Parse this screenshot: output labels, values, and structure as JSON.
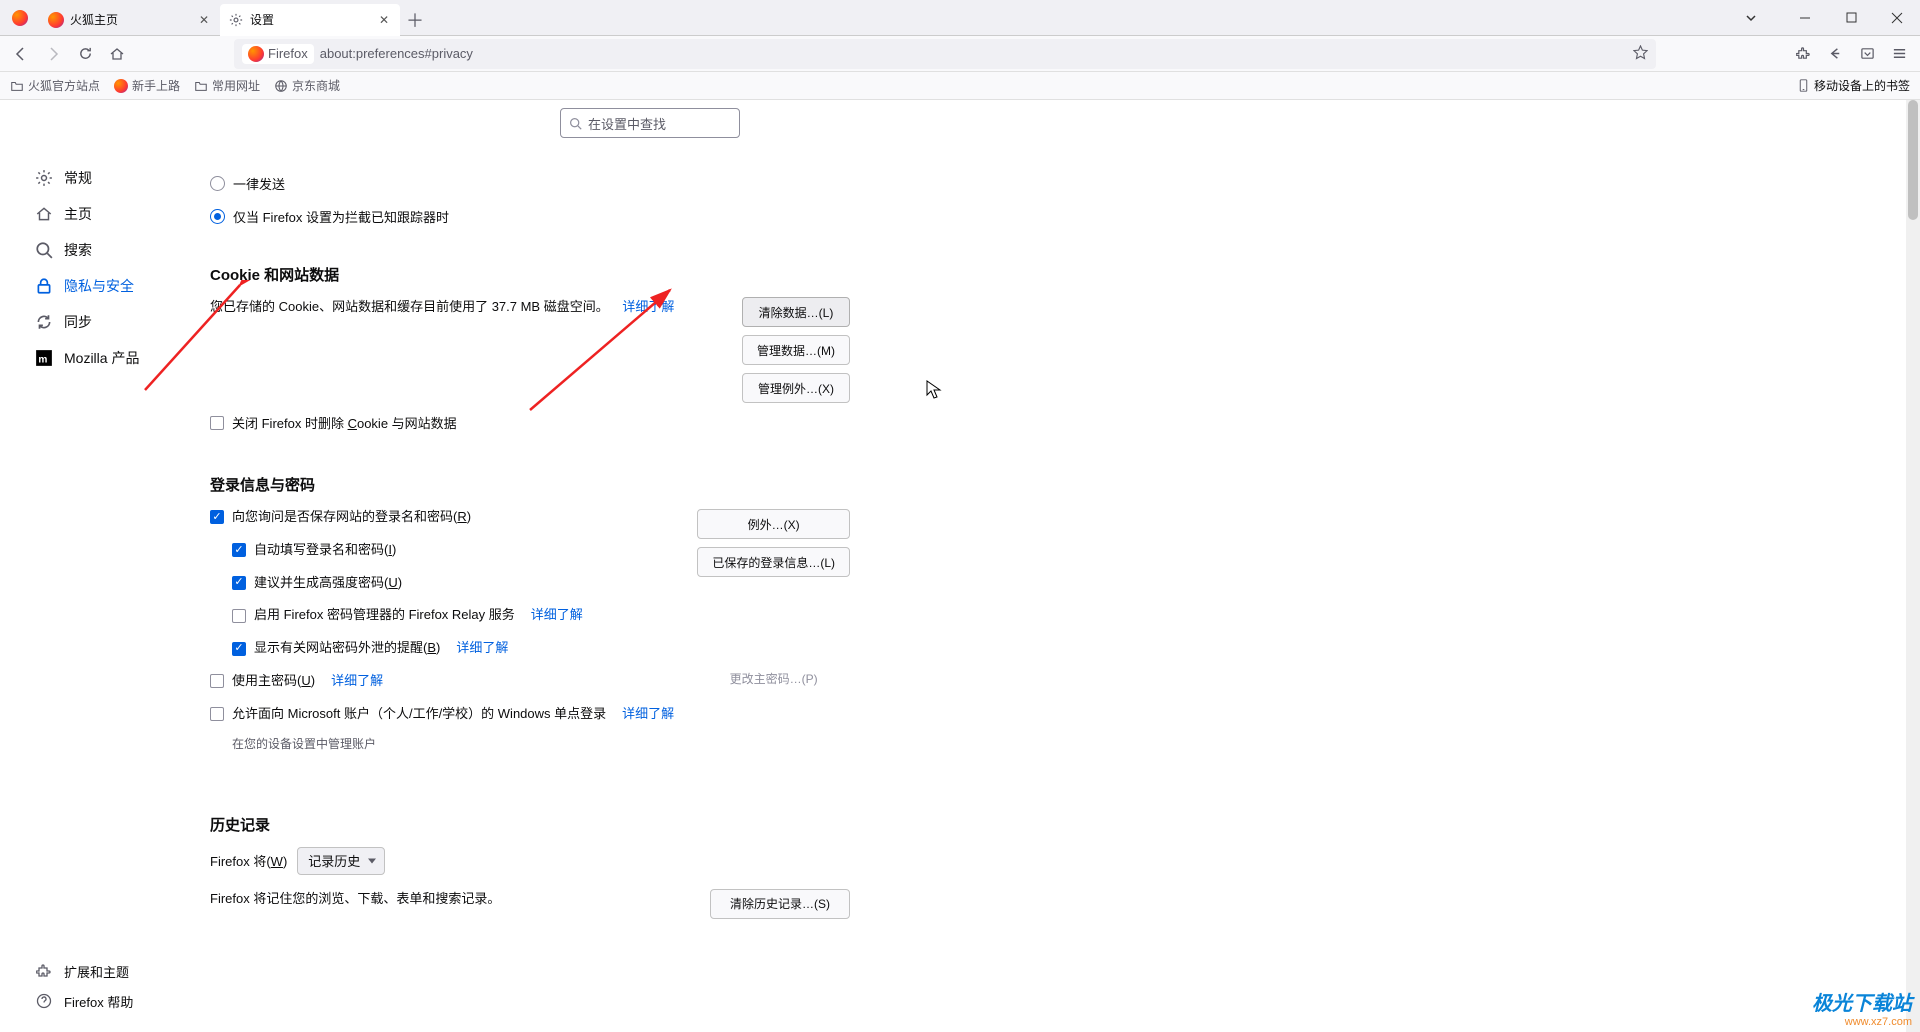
{
  "tabs": [
    {
      "title": "火狐主页",
      "active": false
    },
    {
      "title": "设置",
      "active": true
    }
  ],
  "url_identity": "Firefox",
  "url_path": "about:preferences#privacy",
  "bookmarks": [
    {
      "label": "火狐官方站点",
      "icon": "folder"
    },
    {
      "label": "新手上路",
      "icon": "firefox"
    },
    {
      "label": "常用网址",
      "icon": "folder"
    },
    {
      "label": "京东商城",
      "icon": "globe"
    }
  ],
  "mobile_bookmarks": "移动设备上的书签",
  "search_placeholder": "在设置中查找",
  "sidebar": {
    "items": [
      {
        "key": "general",
        "label": "常规"
      },
      {
        "key": "home",
        "label": "主页"
      },
      {
        "key": "search",
        "label": "搜索"
      },
      {
        "key": "privacy",
        "label": "隐私与安全"
      },
      {
        "key": "sync",
        "label": "同步"
      },
      {
        "key": "mozilla",
        "label": "Mozilla 产品"
      }
    ],
    "bottom": [
      {
        "key": "extensions",
        "label": "扩展和主题"
      },
      {
        "key": "help",
        "label": "Firefox 帮助"
      }
    ]
  },
  "tracking": {
    "radio_always": "一律发送",
    "radio_only_block": "仅当 Firefox 设置为拦截已知跟踪器时"
  },
  "cookies": {
    "title": "Cookie 和网站数据",
    "desc_prefix": "您已存储的 Cookie、网站数据和缓存目前使用了 37.7 MB 磁盘空间。",
    "learn_more": "详细了解",
    "clear_data": "清除数据…(L)",
    "manage_data": "管理数据…(M)",
    "manage_exceptions": "管理例外…(X)",
    "delete_on_close": "关闭 Firefox 时删除 Cookie 与网站数据"
  },
  "logins": {
    "title": "登录信息与密码",
    "ask_save": "向您询问是否保存网站的登录名和密码(R)",
    "autofill": "自动填写登录名和密码(I)",
    "suggest_strong": "建议并生成高强度密码(U)",
    "relay": "启用 Firefox 密码管理器的 Firefox Relay 服务",
    "relay_learn": "详细了解",
    "breach_alerts": "显示有关网站密码外泄的提醒(B)",
    "breach_learn": "详细了解",
    "primary_password": "使用主密码(U)",
    "primary_learn": "详细了解",
    "ms_sso": "允许面向 Microsoft 账户（个人/工作/学校）的 Windows 单点登录",
    "ms_sso_learn": "详细了解",
    "ms_sso_helper": "在您的设备设置中管理账户",
    "exceptions": "例外…(X)",
    "saved_logins": "已保存的登录信息…(L)",
    "change_primary": "更改主密码…(P)"
  },
  "history": {
    "title": "历史记录",
    "firefox_will": "Firefox 将(W)",
    "dropdown_value": "记录历史",
    "desc": "Firefox 将记住您的浏览、下载、表单和搜索记录。",
    "clear_history": "清除历史记录…(S)"
  },
  "watermark": {
    "name": "极光下载站",
    "url": "www.xz7.com"
  }
}
